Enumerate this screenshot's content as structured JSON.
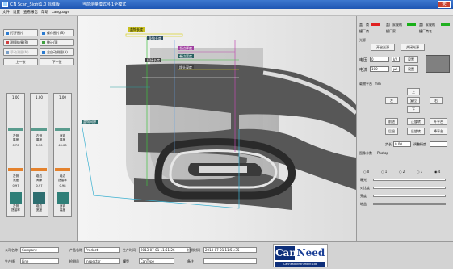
{
  "window": {
    "title": "CN Scan_Sight1.0 标准版",
    "subtitle": "当前测量模式M-1全模式",
    "close": "关"
  },
  "menu": [
    "文件",
    "设置",
    "查看报告",
    "帮助",
    "Language"
  ],
  "left_buttons": {
    "open_image": "打开图片",
    "save_image": "保存图片(S)",
    "save_result": "测量结果(R)",
    "analyze": "统计/测",
    "manual_measure": "手动测量(M)",
    "auto_measure": "全自动测量(A)",
    "prev": "上一张",
    "next": "下一张"
  },
  "strips": [
    {
      "top": "1.00",
      "l1": "左侧",
      "l2": "厚度",
      "v1": "0.70",
      "l3": "左侧",
      "l4": "深度",
      "v2": "0.97",
      "l5": "左侧",
      "l6": "搭接率"
    },
    {
      "top": "1.00",
      "l1": "右侧",
      "l2": "厚度",
      "v1": "0.70",
      "l3": "卷边",
      "l4": "间隙",
      "v2": "0.97",
      "l5": "卷边",
      "l6": "宽度"
    },
    {
      "top": "1.00",
      "l1": "身钩",
      "l2": "厚度",
      "v1": "40.00",
      "l3": "卷边",
      "l4": "搭接率",
      "v2": "0.98",
      "l5": "身钩",
      "l6": "高度"
    }
  ],
  "overlay_labels": [
    "盖钩长度",
    "身钩长度",
    "卷边厚度",
    "卷边宽度",
    "搭接长度",
    "埋头深度",
    "盖钩间隙"
  ],
  "right_panel": {
    "status_labels": [
      "盖厂商",
      "盖厂家规格",
      "盖厂家规格",
      "罐厂商",
      "罐厂家",
      "罐厂商名"
    ],
    "status_colors": [
      "#e02020",
      "#18b018",
      "#20b020"
    ],
    "section_label": "光源",
    "btn_open_light": "开启光源",
    "btn_close_light": "关闭光源",
    "voltage_label": "电压",
    "voltage_value": "0",
    "voltage_unit": "kV",
    "voltage_btn": "设置",
    "current_label": "电流",
    "current_value": "100",
    "current_unit": "μA",
    "current_btn": "设置",
    "table_label": "载物平台",
    "table_unit": "mm",
    "btn_up": "上",
    "btn_left": "左",
    "btn_reset": "复位",
    "btn_right": "右",
    "btn_down": "下",
    "btn_forward": "前进",
    "btn_fwd_rot": "正旋转",
    "btn_lift": "升平台",
    "btn_back": "后退",
    "btn_rev_rot": "反旋转",
    "btn_lower": "降平台",
    "step_label": "步长",
    "step_value": "0.00",
    "step_unit": "调整精度",
    "mode_label": "图像参数",
    "mode_value": "Photop",
    "radio_labels": [
      "0",
      "1",
      "2",
      "3",
      "4"
    ],
    "slider_labels": [
      "曝光",
      "对比度",
      "亮度",
      "增益"
    ]
  },
  "bottom": {
    "company_label": "公司名称",
    "company_value": "Company",
    "product_label": "产品名称",
    "product_value": "Product",
    "prod_time_label": "生产时间",
    "prod_time_value": "2013-07-01 11:51:26",
    "check_time_label": "检测时间",
    "check_time_value": "2013-07-01 11:51:35",
    "line_label": "生产线",
    "line_value": "Line",
    "inspector_label": "检测员",
    "inspector_value": "Inspector",
    "cap_label": "罐型",
    "cap_value": "CanType",
    "note_label": "备注",
    "note_value": "",
    "logo_can": "Can",
    "logo_need": "Need",
    "logo_tag": "Cannead Instrument Ltd."
  }
}
